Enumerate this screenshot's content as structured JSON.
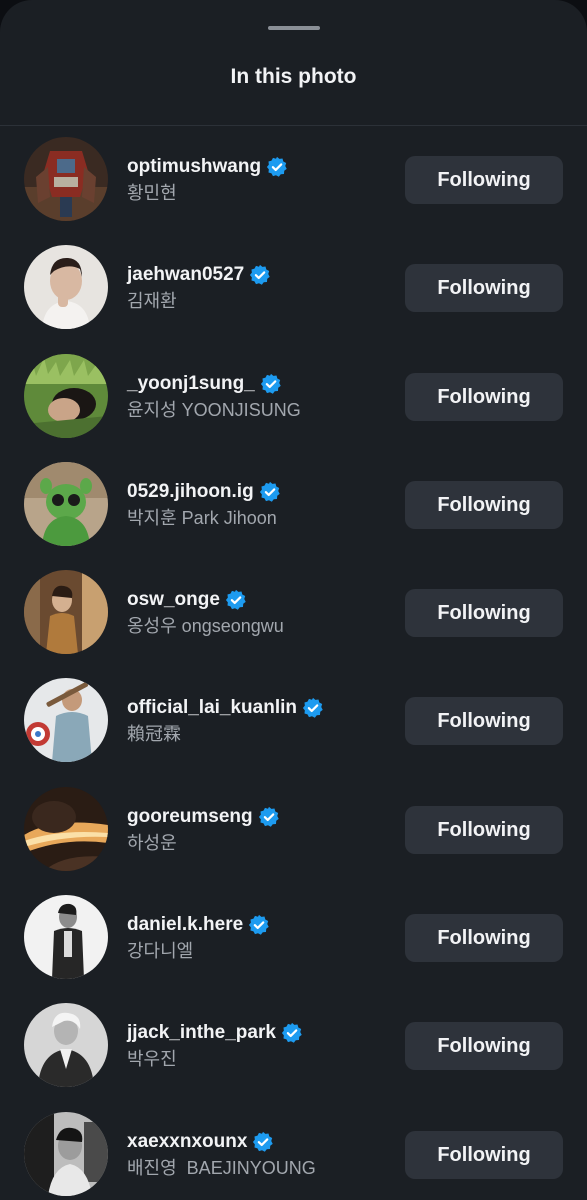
{
  "sheet": {
    "title": "In this photo"
  },
  "people": [
    {
      "username": "optimushwang",
      "name": "황민현",
      "verified": true,
      "button": "Following"
    },
    {
      "username": "jaehwan0527",
      "name": "김재환",
      "verified": true,
      "button": "Following"
    },
    {
      "username": "_yoonj1sung_",
      "name": "윤지성 YOONJISUNG",
      "verified": true,
      "button": "Following"
    },
    {
      "username": "0529.jihoon.ig",
      "name": "박지훈 Park Jihoon",
      "verified": true,
      "button": "Following"
    },
    {
      "username": "osw_onge",
      "name": "옹성우 ongseongwu",
      "verified": true,
      "button": "Following"
    },
    {
      "username": "official_lai_kuanlin",
      "name": "賴冠霖",
      "verified": true,
      "button": "Following"
    },
    {
      "username": "gooreumseng",
      "name": "하성운",
      "verified": true,
      "button": "Following"
    },
    {
      "username": "daniel.k.here",
      "name": "강다니엘",
      "verified": true,
      "button": "Following"
    },
    {
      "username": "jjack_inthe_park",
      "name": "박우진",
      "verified": true,
      "button": "Following"
    },
    {
      "username": "xaexxnxounx",
      "name": "배진영  BAEJINYOUNG",
      "verified": true,
      "button": "Following"
    }
  ],
  "colors": {
    "sheet_background": "#1b1f24",
    "button_background": "#2e333b",
    "verified_badge": "#1d9bf0"
  }
}
